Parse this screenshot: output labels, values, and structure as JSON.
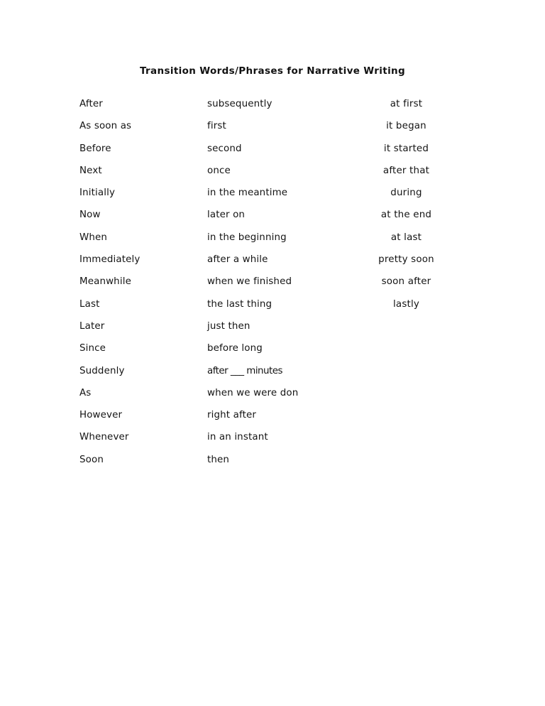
{
  "document": {
    "title": "Transition Words/Phrases for Narrative Writing"
  },
  "columns": [
    {
      "name": "column-1",
      "items": [
        "After",
        "As soon as",
        "Before",
        "Next",
        "Initially",
        "Now",
        "When",
        "Immediately",
        "Meanwhile",
        "Last",
        "Later",
        "Since",
        "Suddenly",
        "As",
        "However",
        "Whenever",
        "Soon"
      ]
    },
    {
      "name": "column-2",
      "items": [
        "subsequently",
        "first",
        "second",
        "once",
        "in the meantime",
        "later on",
        "in the beginning",
        "after a while",
        "when we finished",
        "the last thing",
        "just then",
        "before long",
        "after ___ minutes",
        "when we were don",
        "right after",
        "in an instant",
        "then"
      ]
    },
    {
      "name": "column-3",
      "items": [
        "at first",
        "it began",
        "it started",
        "after that",
        "during",
        "at the end",
        "at last",
        "pretty soon",
        "soon after",
        "lastly"
      ]
    }
  ]
}
